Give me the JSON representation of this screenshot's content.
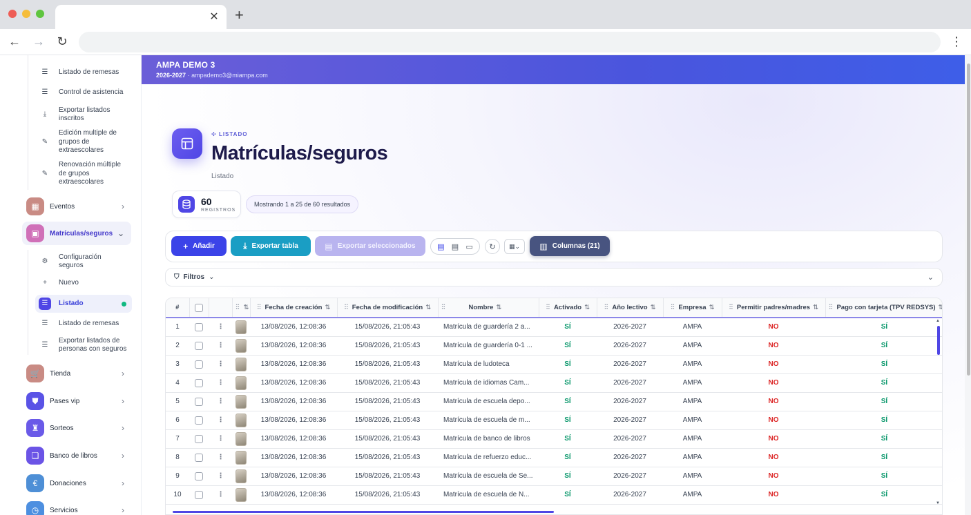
{
  "browser": {
    "close_glyph": "✕",
    "newtab_glyph": "+",
    "back_glyph": "←",
    "forward_glyph": "→",
    "reload_glyph": "↻",
    "menu_glyph": "⋮"
  },
  "banner": {
    "title": "AMPA DEMO 3",
    "year": "2026-2027",
    "email": "ampademo3@miampa.com"
  },
  "sidebar": {
    "top_sub": [
      {
        "label": "Listado de remesas",
        "icon": "list-icon",
        "glyph": "☰"
      },
      {
        "label": "Control de asistencia",
        "icon": "list-icon",
        "glyph": "☰"
      },
      {
        "label": "Exportar listados inscritos",
        "icon": "download-icon",
        "glyph": "⤓"
      },
      {
        "label": "Edición multiple de grupos de extraescolares",
        "icon": "edit-icon",
        "glyph": "✎"
      },
      {
        "label": "Renovación múltiple de grupos extraescolares",
        "icon": "edit-icon",
        "glyph": "✎"
      }
    ],
    "eventos": {
      "label": "Eventos",
      "glyph": "▦",
      "color": "#c98b84"
    },
    "matriculas": {
      "label": "Matrículas/seguros",
      "glyph": "▣",
      "color": "#d070b8"
    },
    "mat_sub": [
      {
        "label": "Configuración seguros",
        "icon": "gear-icon",
        "glyph": "⚙"
      },
      {
        "label": "Nuevo",
        "icon": "plus-icon",
        "glyph": "+"
      },
      {
        "label": "Listado",
        "icon": "list-icon",
        "glyph": "☰"
      },
      {
        "label": "Listado de remesas",
        "icon": "list-icon",
        "glyph": "☰"
      },
      {
        "label": "Exportar listados de personas con seguros",
        "icon": "list-icon",
        "glyph": "☰"
      }
    ],
    "modules": [
      {
        "label": "Tienda",
        "glyph": "🛒",
        "color": "#c98b84"
      },
      {
        "label": "Pases vip",
        "glyph": "⛊",
        "color": "#5a53e6"
      },
      {
        "label": "Sorteos",
        "glyph": "♜",
        "color": "#6a5ae8"
      },
      {
        "label": "Banco de libros",
        "glyph": "❏",
        "color": "#6b54e6"
      },
      {
        "label": "Donaciones",
        "glyph": "€",
        "color": "#4e8fd6"
      },
      {
        "label": "Servicios",
        "glyph": "◷",
        "color": "#4d8fe0"
      }
    ],
    "chevron": "›",
    "chevron_open": "⌄"
  },
  "page": {
    "eyebrow": "LISTADO",
    "title": "Matrículas/seguros",
    "subtitle": "Listado",
    "count": "60",
    "count_label": "REGISTROS",
    "showing": "Mostrando 1 a 25 de 60 resultados"
  },
  "toolbar": {
    "add": "Añadir",
    "export": "Exportar tabla",
    "export_selected": "Exportar seleccionados",
    "columns": "Columnas (21)",
    "refresh_glyph": "↻",
    "density_glyph": "▦⌄"
  },
  "filters": {
    "label": "Filtros",
    "chevron": "⌄"
  },
  "table": {
    "headers": {
      "num": "#",
      "fecha_creacion": "Fecha de creación",
      "fecha_modificacion": "Fecha de modificación",
      "nombre": "Nombre",
      "activado": "Activado",
      "ano": "Año lectivo",
      "empresa": "Empresa",
      "permitir": "Permitir padres/madres",
      "pago": "Pago con tarjeta (TPV REDSYS)"
    },
    "rows": [
      {
        "n": "1",
        "c": "13/08/2026, 12:08:36",
        "m": "15/08/2026, 21:05:43",
        "name": "Matrícula de guardería 2 a...",
        "act": "SÍ",
        "year": "2026-2027",
        "emp": "AMPA",
        "perm": "NO",
        "pay": "SÍ"
      },
      {
        "n": "2",
        "c": "13/08/2026, 12:08:36",
        "m": "15/08/2026, 21:05:43",
        "name": "Matrícula de guardería 0-1 ...",
        "act": "SÍ",
        "year": "2026-2027",
        "emp": "AMPA",
        "perm": "NO",
        "pay": "SÍ"
      },
      {
        "n": "3",
        "c": "13/08/2026, 12:08:36",
        "m": "15/08/2026, 21:05:43",
        "name": "Matrícula de ludoteca",
        "act": "SÍ",
        "year": "2026-2027",
        "emp": "AMPA",
        "perm": "NO",
        "pay": "SÍ"
      },
      {
        "n": "4",
        "c": "13/08/2026, 12:08:36",
        "m": "15/08/2026, 21:05:43",
        "name": "Matrícula de idiomas Cam...",
        "act": "SÍ",
        "year": "2026-2027",
        "emp": "AMPA",
        "perm": "NO",
        "pay": "SÍ"
      },
      {
        "n": "5",
        "c": "13/08/2026, 12:08:36",
        "m": "15/08/2026, 21:05:43",
        "name": "Matrícula de escuela depo...",
        "act": "SÍ",
        "year": "2026-2027",
        "emp": "AMPA",
        "perm": "NO",
        "pay": "SÍ"
      },
      {
        "n": "6",
        "c": "13/08/2026, 12:08:36",
        "m": "15/08/2026, 21:05:43",
        "name": "Matrícula de escuela de m...",
        "act": "SÍ",
        "year": "2026-2027",
        "emp": "AMPA",
        "perm": "NO",
        "pay": "SÍ"
      },
      {
        "n": "7",
        "c": "13/08/2026, 12:08:36",
        "m": "15/08/2026, 21:05:43",
        "name": "Matrícula de banco de libros",
        "act": "SÍ",
        "year": "2026-2027",
        "emp": "AMPA",
        "perm": "NO",
        "pay": "SÍ"
      },
      {
        "n": "8",
        "c": "13/08/2026, 12:08:36",
        "m": "15/08/2026, 21:05:43",
        "name": "Matrícula de refuerzo educ...",
        "act": "SÍ",
        "year": "2026-2027",
        "emp": "AMPA",
        "perm": "NO",
        "pay": "SÍ"
      },
      {
        "n": "9",
        "c": "13/08/2026, 12:08:36",
        "m": "15/08/2026, 21:05:43",
        "name": "Matrícula de escuela de Se...",
        "act": "SÍ",
        "year": "2026-2027",
        "emp": "AMPA",
        "perm": "NO",
        "pay": "SÍ"
      },
      {
        "n": "10",
        "c": "13/08/2026, 12:08:36",
        "m": "15/08/2026, 21:05:43",
        "name": "Matrícula de escuela de N...",
        "act": "SÍ",
        "year": "2026-2027",
        "emp": "AMPA",
        "perm": "NO",
        "pay": "SÍ"
      }
    ]
  },
  "colors": {
    "accent": "#4f46e5",
    "yes": "#059669",
    "no": "#dc2626",
    "export": "#1a9ec4",
    "columns": "#485480"
  }
}
